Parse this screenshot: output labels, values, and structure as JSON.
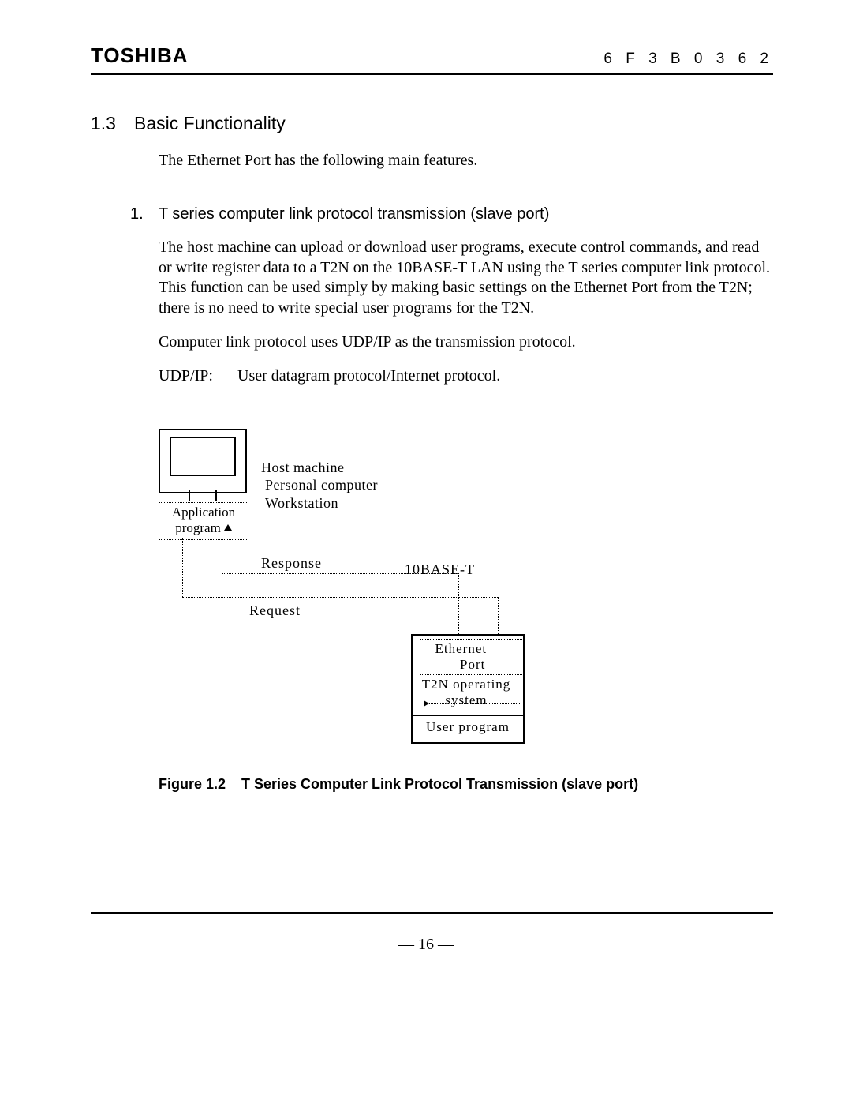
{
  "header": {
    "brand": "TOSHIBA",
    "doc_code": "6 F 3 B 0 3 6 2"
  },
  "section": {
    "number": "1.3",
    "title": "Basic Functionality",
    "intro": "The Ethernet Port has the following main features."
  },
  "item1": {
    "number": "1.",
    "heading": "T series computer link protocol transmission (slave port)",
    "para1": "The host machine can upload or download user programs, execute control commands, and read or write register data to a T2N on the 10BASE-T LAN using the T series computer link protocol. This function can be used simply by making basic settings on the Ethernet Port from the T2N; there is no need to write special user programs for the T2N.",
    "para2": "Computer link protocol uses UDP/IP as the transmission protocol.",
    "def_term": "UDP/IP:",
    "def_text": "User datagram protocol/Internet protocol."
  },
  "figure": {
    "host_label_l1": "Host machine",
    "host_label_l2": "Personal computer",
    "host_label_l3": "Workstation",
    "app_l1": "Application",
    "app_l2": "program",
    "response": "Response",
    "request": "Request",
    "baset": "10BASE-T",
    "port_l1": "Ethernet",
    "port_l2": "Port",
    "os_l1": "T2N operating",
    "os_l2": "system",
    "user_prog": "User program",
    "caption_num": "Figure 1.2",
    "caption_text": "T Series Computer Link Protocol Transmission (slave port)"
  },
  "page_number": "—  16  —"
}
